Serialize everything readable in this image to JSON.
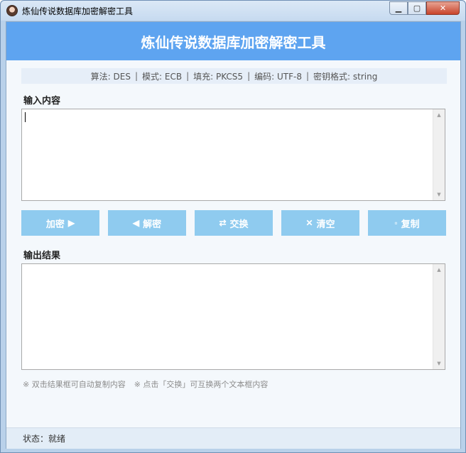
{
  "window": {
    "title": "炼仙传说数据库加密解密工具",
    "controls": {
      "minimize": "▁",
      "maximize": "▢",
      "close": "✕"
    }
  },
  "header": {
    "title": "炼仙传说数据库加密解密工具"
  },
  "info_bar": {
    "items": [
      "算法: DES",
      "模式: ECB",
      "填充: PKCS5",
      "编码: UTF-8",
      "密钥格式: string"
    ],
    "separator": "|"
  },
  "input": {
    "label": "输入内容",
    "value": ""
  },
  "buttons": {
    "encrypt": {
      "label": "加密",
      "icon": "▶"
    },
    "decrypt": {
      "label": "解密",
      "icon": "◀"
    },
    "swap": {
      "label": "交换",
      "icon": "⇄"
    },
    "clear": {
      "label": "清空",
      "icon": "✕"
    },
    "copy": {
      "label": "复制",
      "icon": "▫"
    }
  },
  "output": {
    "label": "输出结果",
    "value": ""
  },
  "tips": [
    "※ 双击结果框可自动复制内容",
    "※ 点击「交换」可互换两个文本框内容"
  ],
  "status": {
    "text": "状态：就绪"
  },
  "colors": {
    "header_bg": "#5ea4f0",
    "button_bg": "#8fcbef",
    "info_bar_bg": "#e6eef8",
    "status_bar_bg": "#e3edf7"
  }
}
